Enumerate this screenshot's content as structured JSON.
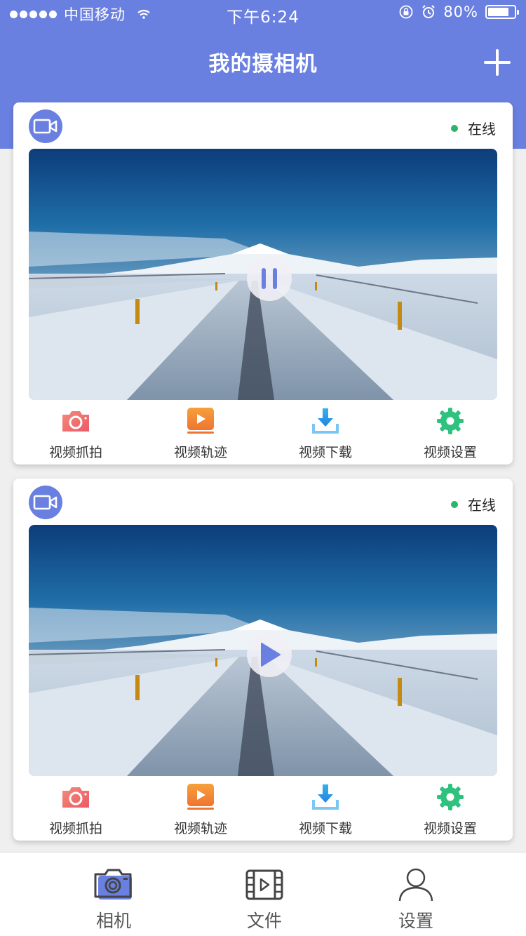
{
  "status_bar": {
    "carrier": "中国移动",
    "time": "下午6:24",
    "battery": "80%"
  },
  "header": {
    "title": "我的摄相机"
  },
  "cameras": [
    {
      "status": "在线",
      "playback": "pause-icon",
      "actions": [
        {
          "label": "视频抓拍",
          "icon": "camera-icon",
          "color": "#f07070"
        },
        {
          "label": "视频轨迹",
          "icon": "play-box-icon",
          "color": "#f28a2e"
        },
        {
          "label": "视频下载",
          "icon": "download-icon",
          "color": "#2d9fe8"
        },
        {
          "label": "视频设置",
          "icon": "gear-icon",
          "color": "#2ec27e"
        }
      ]
    },
    {
      "status": "在线",
      "playback": "play-icon",
      "actions": [
        {
          "label": "视频抓拍",
          "icon": "camera-icon",
          "color": "#f07070"
        },
        {
          "label": "视频轨迹",
          "icon": "play-box-icon",
          "color": "#f28a2e"
        },
        {
          "label": "视频下载",
          "icon": "download-icon",
          "color": "#2d9fe8"
        },
        {
          "label": "视频设置",
          "icon": "gear-icon",
          "color": "#2ec27e"
        }
      ]
    }
  ],
  "tab_bar": {
    "tabs": [
      {
        "label": "相机",
        "icon": "camera-tab-icon",
        "active": true
      },
      {
        "label": "文件",
        "icon": "film-icon",
        "active": false
      },
      {
        "label": "设置",
        "icon": "user-icon",
        "active": false
      }
    ]
  },
  "colors": {
    "accent": "#6a80e0",
    "online": "#2db36b"
  }
}
